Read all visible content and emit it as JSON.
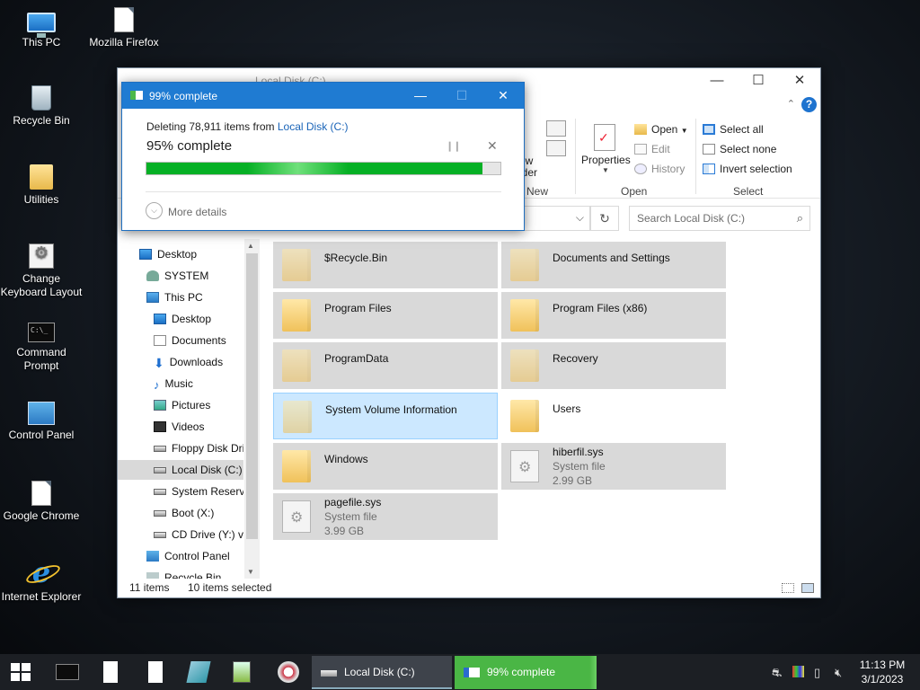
{
  "desktop": {
    "icons": [
      {
        "label": "This PC",
        "icon": "computer-icon"
      },
      {
        "label": "Mozilla Firefox",
        "icon": "document-icon"
      },
      {
        "label": "Recycle Bin",
        "icon": "recycle-bin-icon"
      },
      {
        "label": "Utilities",
        "icon": "folder-icon"
      },
      {
        "label": "Change Keyboard Layout",
        "icon": "settings-icon"
      },
      {
        "label": "Command Prompt",
        "icon": "terminal-icon"
      },
      {
        "label": "Control Panel",
        "icon": "control-panel-icon"
      },
      {
        "label": "Google Chrome",
        "icon": "document-icon"
      },
      {
        "label": "Internet Explorer",
        "icon": "internet-explorer-icon"
      }
    ]
  },
  "explorer": {
    "title": "Local Disk (C:)",
    "ribbon": {
      "new_group": "New",
      "new_folder_partial": "ew",
      "new_folder_partial2": "lder",
      "open_group": "Open",
      "properties": "Properties",
      "open": "Open",
      "edit": "Edit",
      "history": "History",
      "select_group": "Select",
      "select_all": "Select all",
      "select_none": "Select none",
      "invert_selection": "Invert selection"
    },
    "search_placeholder": "Search Local Disk (C:)",
    "nav": [
      {
        "label": "Desktop",
        "icon": "i-desk",
        "indent": 0
      },
      {
        "label": "SYSTEM",
        "icon": "i-user",
        "indent": 1
      },
      {
        "label": "This PC",
        "icon": "i-pc",
        "indent": 1
      },
      {
        "label": "Desktop",
        "icon": "i-desk",
        "indent": 2
      },
      {
        "label": "Documents",
        "icon": "i-doc",
        "indent": 2
      },
      {
        "label": "Downloads",
        "icon": "i-down",
        "indent": 2
      },
      {
        "label": "Music",
        "icon": "i-music",
        "indent": 2
      },
      {
        "label": "Pictures",
        "icon": "i-pic",
        "indent": 2
      },
      {
        "label": "Videos",
        "icon": "i-vid",
        "indent": 2
      },
      {
        "label": "Floppy Disk Dri",
        "icon": "i-drive",
        "indent": 2
      },
      {
        "label": "Local Disk (C:)",
        "icon": "i-drive",
        "indent": 2,
        "selected": true
      },
      {
        "label": "System Reserve",
        "icon": "i-drive",
        "indent": 2
      },
      {
        "label": "Boot (X:)",
        "icon": "i-drive",
        "indent": 2
      },
      {
        "label": "CD Drive (Y:) vi",
        "icon": "i-drive",
        "indent": 2
      },
      {
        "label": "Control Panel",
        "icon": "i-cp",
        "indent": 1
      },
      {
        "label": "Recycle Bin",
        "icon": "i-bin",
        "indent": 1
      }
    ],
    "files": [
      {
        "name": "$Recycle.Bin",
        "kind": "folder",
        "state": "selected-faded"
      },
      {
        "name": "Documents and Settings",
        "kind": "folder",
        "state": "selected-faded"
      },
      {
        "name": "Program Files",
        "kind": "folder",
        "state": "selected"
      },
      {
        "name": "Program Files (x86)",
        "kind": "folder",
        "state": "selected"
      },
      {
        "name": "ProgramData",
        "kind": "folder",
        "state": "selected-faded"
      },
      {
        "name": "Recovery",
        "kind": "folder",
        "state": "selected-faded"
      },
      {
        "name": "System Volume Information",
        "kind": "folder",
        "state": "highlight"
      },
      {
        "name": "Users",
        "kind": "folder",
        "state": "normal"
      },
      {
        "name": "Windows",
        "kind": "folder",
        "state": "selected"
      },
      {
        "name": "hiberfil.sys",
        "kind": "sysfile",
        "type": "System file",
        "size": "2.99 GB",
        "state": "selected"
      },
      {
        "name": "pagefile.sys",
        "kind": "sysfile",
        "type": "System file",
        "size": "3.99 GB",
        "state": "selected"
      }
    ],
    "status": {
      "items": "11 items",
      "selected": "10 items selected"
    }
  },
  "dialog": {
    "title": "99% complete",
    "line1_prefix": "Deleting 78,911 items from ",
    "line1_link": "Local Disk (C:)",
    "percent_text": "95% complete",
    "progress": 0.95,
    "more_details": "More details"
  },
  "taskbar": {
    "explorer_task": "Local Disk (C:)",
    "progress_task": "99% complete",
    "time": "11:13 PM",
    "date": "3/1/2023"
  },
  "colors": {
    "accent": "#1f7bd2",
    "progress_green": "#06b025",
    "selection": "#d9d9d9",
    "highlight": "#cce8ff"
  }
}
